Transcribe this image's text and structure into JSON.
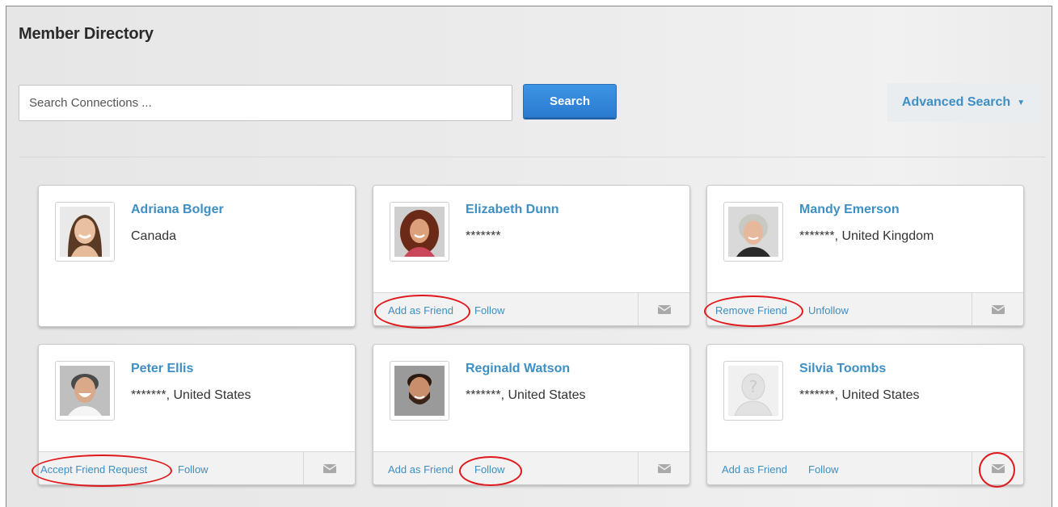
{
  "page": {
    "title": "Member Directory"
  },
  "search": {
    "placeholder": "Search Connections ...",
    "button_label": "Search",
    "advanced_label": "Advanced Search",
    "advanced_caret": "▼"
  },
  "members": [
    {
      "name": "Adriana Bolger",
      "location": "Canada",
      "photo": "photo-woman-brown-hair"
    },
    {
      "name": "Elizabeth Dunn",
      "location": "*******",
      "photo": "photo-woman-curly-hair",
      "action_1": "Add as Friend",
      "action_2": "Follow"
    },
    {
      "name": "Mandy Emerson",
      "location": "*******, United Kingdom",
      "photo": "photo-woman-grey-hair",
      "action_1": "Remove Friend",
      "action_2": "Unfollow"
    },
    {
      "name": "Peter Ellis",
      "location": "*******, United States",
      "photo": "photo-man-laughing",
      "action_1": "Accept Friend Request",
      "action_2": "Follow"
    },
    {
      "name": "Reginald Watson",
      "location": "*******, United States",
      "photo": "photo-man-beard",
      "action_1": "Add as Friend",
      "action_2": "Follow"
    },
    {
      "name": "Silvia Toombs",
      "location": "*******, United States",
      "photo": "default-avatar-placeholder",
      "action_1": "Add as Friend",
      "action_2": "Follow"
    }
  ],
  "icons": {
    "message": "envelope-icon",
    "avatar_placeholder": "question-mark-silhouette"
  },
  "colors": {
    "link": "#3d8fc4",
    "button": "#2a7bd0",
    "highlight_ring": "#e0181b"
  }
}
